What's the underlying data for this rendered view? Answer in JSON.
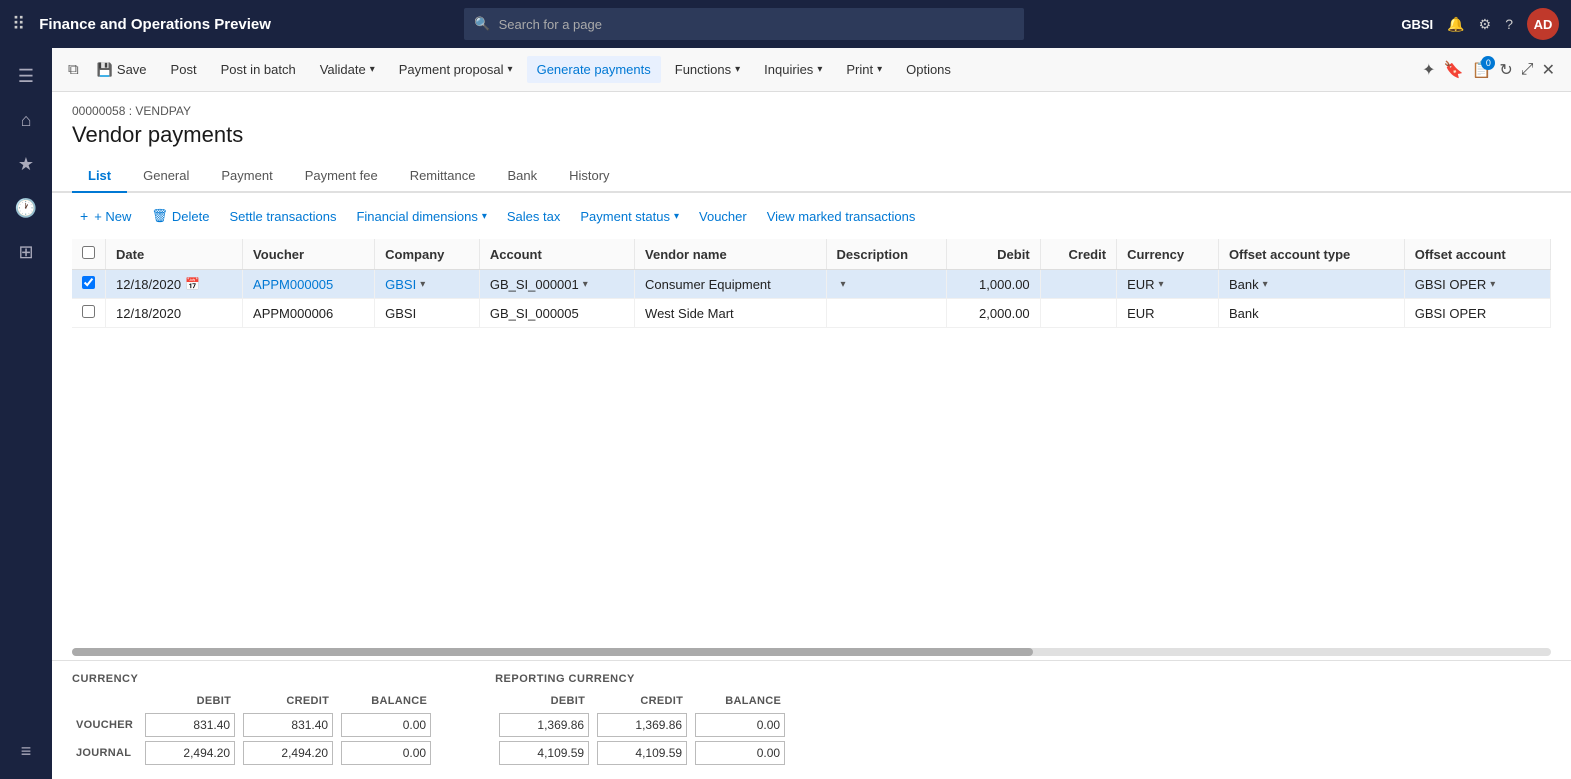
{
  "topBar": {
    "title": "Finance and Operations Preview",
    "searchPlaceholder": "Search for a page",
    "orgLabel": "GBSI",
    "userInitials": "AD"
  },
  "toolbar": {
    "buttons": [
      {
        "id": "save",
        "label": "Save",
        "icon": "💾"
      },
      {
        "id": "post",
        "label": "Post",
        "icon": ""
      },
      {
        "id": "post-batch",
        "label": "Post in batch",
        "icon": ""
      },
      {
        "id": "validate",
        "label": "Validate",
        "icon": "",
        "hasDropdown": true
      },
      {
        "id": "payment-proposal",
        "label": "Payment proposal",
        "icon": "",
        "hasDropdown": true
      },
      {
        "id": "generate-payments",
        "label": "Generate payments",
        "icon": "",
        "active": true
      },
      {
        "id": "functions",
        "label": "Functions",
        "icon": "",
        "hasDropdown": true
      },
      {
        "id": "inquiries",
        "label": "Inquiries",
        "icon": "",
        "hasDropdown": true
      },
      {
        "id": "print",
        "label": "Print",
        "icon": "",
        "hasDropdown": true
      },
      {
        "id": "options",
        "label": "Options",
        "icon": ""
      }
    ]
  },
  "sidebar": {
    "icons": [
      {
        "id": "menu",
        "symbol": "☰"
      },
      {
        "id": "home",
        "symbol": "⌂"
      },
      {
        "id": "favorites",
        "symbol": "★"
      },
      {
        "id": "recent",
        "symbol": "🕐"
      },
      {
        "id": "workspaces",
        "symbol": "⊞"
      },
      {
        "id": "modules",
        "symbol": "≡"
      }
    ]
  },
  "page": {
    "breadcrumb": "00000058 : VENDPAY",
    "title": "Vendor payments"
  },
  "tabs": [
    {
      "id": "list",
      "label": "List",
      "active": true
    },
    {
      "id": "general",
      "label": "General"
    },
    {
      "id": "payment",
      "label": "Payment"
    },
    {
      "id": "payment-fee",
      "label": "Payment fee"
    },
    {
      "id": "remittance",
      "label": "Remittance"
    },
    {
      "id": "bank",
      "label": "Bank"
    },
    {
      "id": "history",
      "label": "History"
    }
  ],
  "actionBar": {
    "newLabel": "+ New",
    "deleteLabel": "Delete",
    "settleLabel": "Settle transactions",
    "financialDimLabel": "Financial dimensions",
    "salesTaxLabel": "Sales tax",
    "paymentStatusLabel": "Payment status",
    "voucherLabel": "Voucher",
    "viewMarkedLabel": "View marked transactions"
  },
  "grid": {
    "columns": [
      {
        "id": "check",
        "label": ""
      },
      {
        "id": "date",
        "label": "Date"
      },
      {
        "id": "voucher",
        "label": "Voucher"
      },
      {
        "id": "company",
        "label": "Company"
      },
      {
        "id": "account",
        "label": "Account"
      },
      {
        "id": "vendor-name",
        "label": "Vendor name"
      },
      {
        "id": "description",
        "label": "Description"
      },
      {
        "id": "debit",
        "label": "Debit",
        "align": "right"
      },
      {
        "id": "credit",
        "label": "Credit",
        "align": "right"
      },
      {
        "id": "currency",
        "label": "Currency"
      },
      {
        "id": "offset-account-type",
        "label": "Offset account type"
      },
      {
        "id": "offset-account",
        "label": "Offset account"
      }
    ],
    "rows": [
      {
        "selected": true,
        "date": "12/18/2020",
        "voucher": "APPM000005",
        "company": "GBSI",
        "account": "GB_SI_000001",
        "vendorName": "Consumer Equipment",
        "description": "",
        "debit": "1,000.00",
        "credit": "",
        "currency": "EUR",
        "offsetAccountType": "Bank",
        "offsetAccount": "GBSI OPER"
      },
      {
        "selected": false,
        "date": "12/18/2020",
        "voucher": "APPM000006",
        "company": "GBSI",
        "account": "GB_SI_000005",
        "vendorName": "West Side Mart",
        "description": "",
        "debit": "2,000.00",
        "credit": "",
        "currency": "EUR",
        "offsetAccountType": "Bank",
        "offsetAccount": "GBSI OPER"
      }
    ]
  },
  "summary": {
    "currencyTitle": "CURRENCY",
    "reportingCurrencyTitle": "REPORTING CURRENCY",
    "headers": [
      "DEBIT",
      "CREDIT",
      "BALANCE"
    ],
    "rows": [
      {
        "label": "VOUCHER",
        "currency": {
          "debit": "831.40",
          "credit": "831.40",
          "balance": "0.00"
        },
        "reporting": {
          "debit": "1,369.86",
          "credit": "1,369.86",
          "balance": "0.00"
        }
      },
      {
        "label": "JOURNAL",
        "currency": {
          "debit": "2,494.20",
          "credit": "2,494.20",
          "balance": "0.00"
        },
        "reporting": {
          "debit": "4,109.59",
          "credit": "4,109.59",
          "balance": "0.00"
        }
      }
    ]
  }
}
